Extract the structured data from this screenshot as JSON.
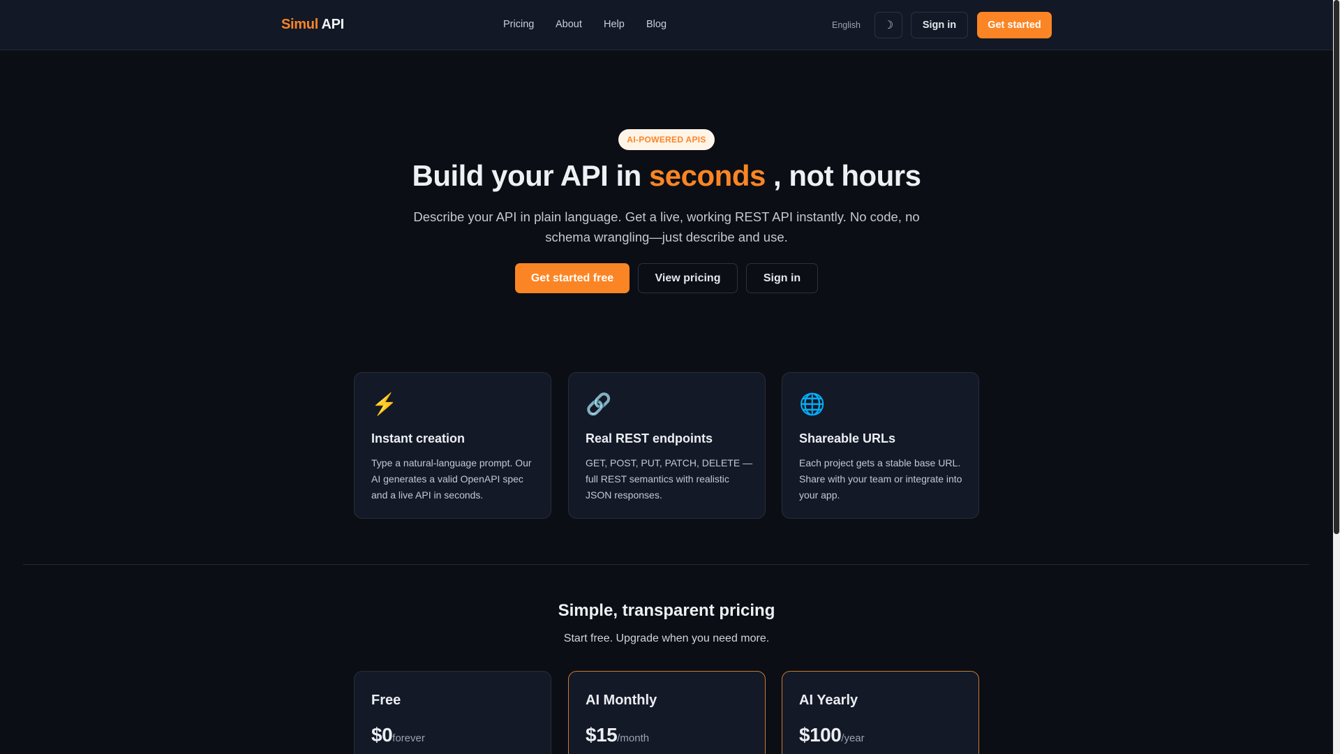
{
  "header": {
    "logo_part1": "Simul",
    "logo_part2": "API",
    "nav": [
      "Pricing",
      "About",
      "Help",
      "Blog"
    ],
    "language": "English",
    "theme_icon": "☽",
    "sign_in": "Sign in",
    "get_started": "Get started"
  },
  "hero": {
    "badge": "AI-POWERED APIS",
    "title_pre": "Build your API in",
    "title_highlight": "seconds",
    "title_post": ", not hours",
    "subtitle": "Describe your API in plain language. Get a live, working REST API instantly. No code, no schema wrangling—just describe and use.",
    "cta_primary": "Get started free",
    "cta_pricing": "View pricing",
    "cta_signin": "Sign in"
  },
  "features": [
    {
      "icon": "⚡",
      "title": "Instant creation",
      "desc": "Type a natural-language prompt. Our AI generates a valid OpenAPI spec and a live API in seconds."
    },
    {
      "icon": "🔗",
      "title": "Real REST endpoints",
      "desc": "GET, POST, PUT, PATCH, DELETE —full REST semantics with realistic JSON responses."
    },
    {
      "icon": "🌐",
      "title": "Shareable URLs",
      "desc": "Each project gets a stable base URL. Share with your team or integrate into your app."
    }
  ],
  "pricing": {
    "title": "Simple, transparent pricing",
    "subtitle": "Start free. Upgrade when you need more.",
    "plans": [
      {
        "name": "Free",
        "price": "$0",
        "period": "forever"
      },
      {
        "name": "AI Monthly",
        "price": "$15",
        "period": "/month"
      },
      {
        "name": "AI Yearly",
        "price": "$100",
        "period": "/year"
      }
    ]
  },
  "colors": {
    "accent": "#fb8524",
    "background": "#0b0e14",
    "card": "#131927"
  }
}
